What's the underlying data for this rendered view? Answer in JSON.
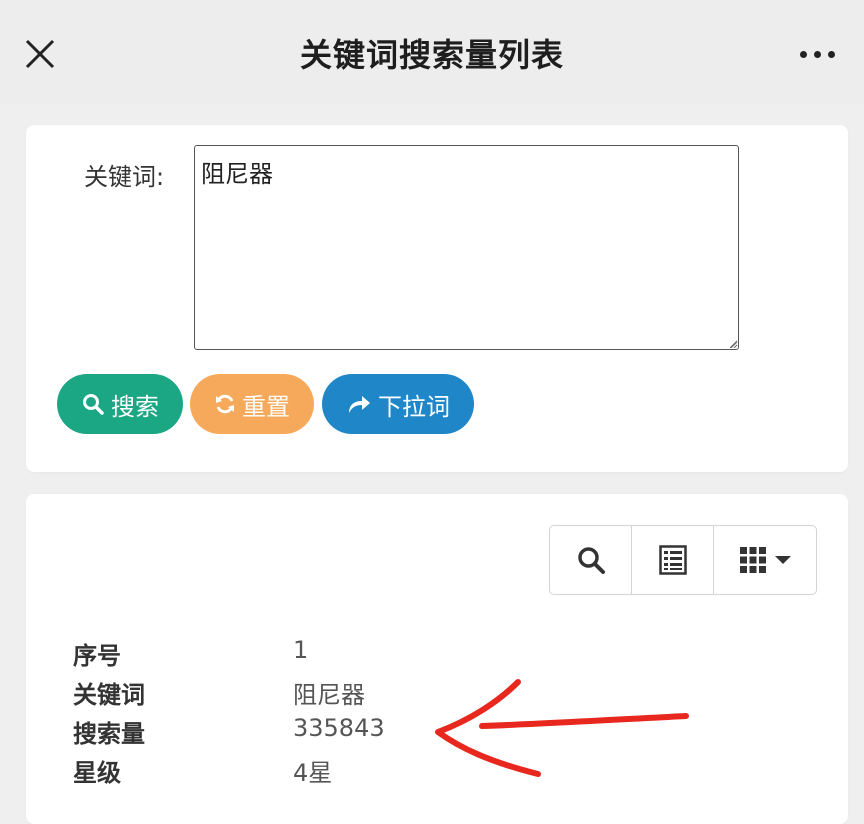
{
  "header": {
    "title": "关键词搜索量列表",
    "close_icon": "close-icon",
    "more_icon": "more-horizontal-icon"
  },
  "form": {
    "keyword_label": "关键词:",
    "keyword_value": "阻尼器",
    "buttons": {
      "search": "搜索",
      "reset": "重置",
      "dropdown_words": "下拉词"
    }
  },
  "toolbar": {
    "icons": [
      "search-icon",
      "list-icon",
      "grid-columns-icon"
    ]
  },
  "result": {
    "rows": [
      {
        "label": "序号",
        "value": "1"
      },
      {
        "label": "关键词",
        "value": "阻尼器"
      },
      {
        "label": "搜索量",
        "value": "335843"
      },
      {
        "label": "星级",
        "value": "4星"
      }
    ]
  },
  "colors": {
    "search_button": "#1ba784",
    "reset_button": "#f6a95a",
    "dropdown_button": "#1f86c8",
    "annotation_arrow": "#e8281e"
  }
}
